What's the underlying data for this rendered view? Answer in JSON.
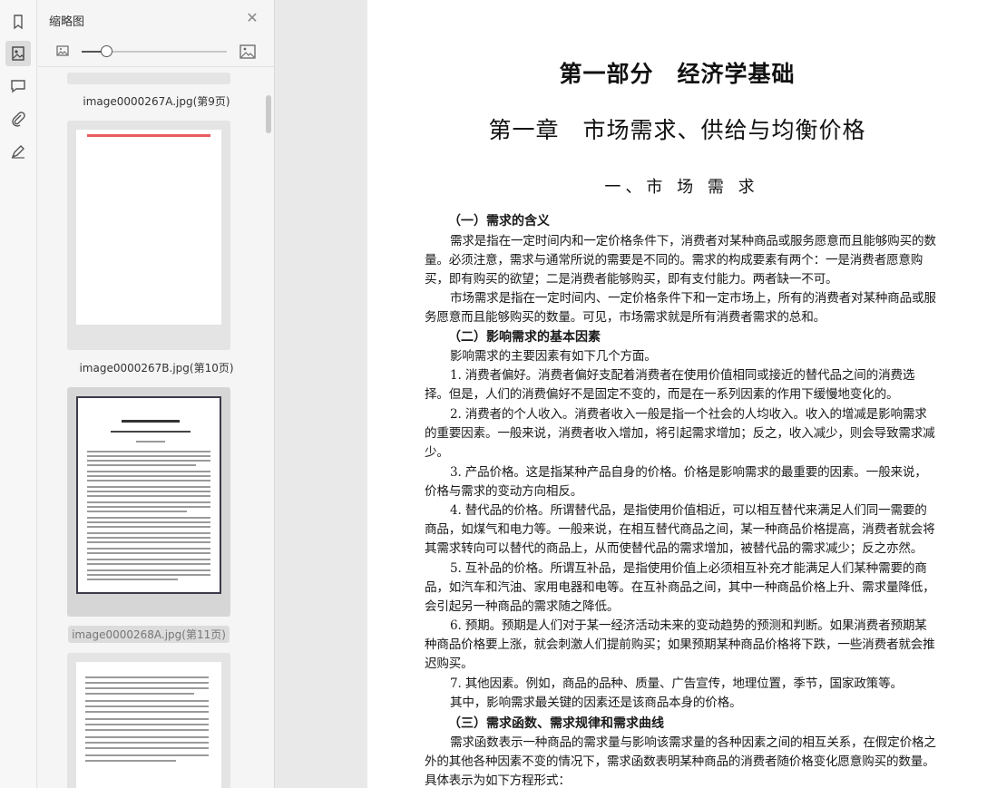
{
  "sidebar": {
    "title": "缩略图",
    "thumbnails": [
      {
        "label": "image0000267A.jpg(第9页)"
      },
      {
        "label": "image0000267B.jpg(第10页)"
      },
      {
        "label": "image0000268A.jpg(第11页)"
      }
    ]
  },
  "document": {
    "part_title": "第一部分　经济学基础",
    "chapter_title": "第一章　市场需求、供给与均衡价格",
    "section_title": "一、市 场 需 求",
    "h1": "（一）需求的含义",
    "p1": "需求是指在一定时间内和一定价格条件下，消费者对某种商品或服务愿意而且能够购买的数量。必须注意，需求与通常所说的需要是不同的。需求的构成要素有两个：一是消费者愿意购买，即有购买的欲望；二是消费者能够购买，即有支付能力。两者缺一不可。",
    "p2": "市场需求是指在一定时间内、一定价格条件下和一定市场上，所有的消费者对某种商品或服务愿意而且能够购买的数量。可见，市场需求就是所有消费者需求的总和。",
    "h2": "（二）影响需求的基本因素",
    "p3": "影响需求的主要因素有如下几个方面。",
    "p4": "1. 消费者偏好。消费者偏好支配着消费者在使用价值相同或接近的替代品之间的消费选择。但是，人们的消费偏好不是固定不变的，而是在一系列因素的作用下缓慢地变化的。",
    "p5": "2. 消费者的个人收入。消费者收入一般是指一个社会的人均收入。收入的增减是影响需求的重要因素。一般来说，消费者收入增加，将引起需求增加；反之，收入减少，则会导致需求减少。",
    "p6": "3. 产品价格。这是指某种产品自身的价格。价格是影响需求的最重要的因素。一般来说，价格与需求的变动方向相反。",
    "p7": "4. 替代品的价格。所谓替代品，是指使用价值相近，可以相互替代来满足人们同一需要的商品，如煤气和电力等。一般来说，在相互替代商品之间，某一种商品价格提高，消费者就会将其需求转向可以替代的商品上，从而使替代品的需求增加，被替代品的需求减少；反之亦然。",
    "p8": "5. 互补品的价格。所谓互补品，是指使用价值上必须相互补充才能满足人们某种需要的商品，如汽车和汽油、家用电器和电等。在互补商品之间，其中一种商品价格上升、需求量降低，会引起另一种商品的需求随之降低。",
    "p9": "6. 预期。预期是人们对于某一经济活动未来的变动趋势的预测和判断。如果消费者预期某种商品价格要上涨，就会刺激人们提前购买；如果预期某种商品价格将下跌，一些消费者就会推迟购买。",
    "p10": "7. 其他因素。例如，商品的品种、质量、广告宣传，地理位置，季节，国家政策等。",
    "p11": "其中，影响需求最关键的因素还是该商品本身的价格。",
    "h3": "（三）需求函数、需求规律和需求曲线",
    "p12": "需求函数表示一种商品的需求量与影响该需求量的各种因素之间的相互关系，在假定价格之外的其他各种因素不变的情况下，需求函数表明某种商品的消费者随价格变化愿意购买的数量。具体表示为如下方程形式："
  },
  "icons": [
    "bookmark-icon",
    "thumbnail-icon",
    "comment-icon",
    "attachment-icon",
    "signature-icon",
    "close-icon",
    "image-small-icon",
    "image-large-icon"
  ]
}
